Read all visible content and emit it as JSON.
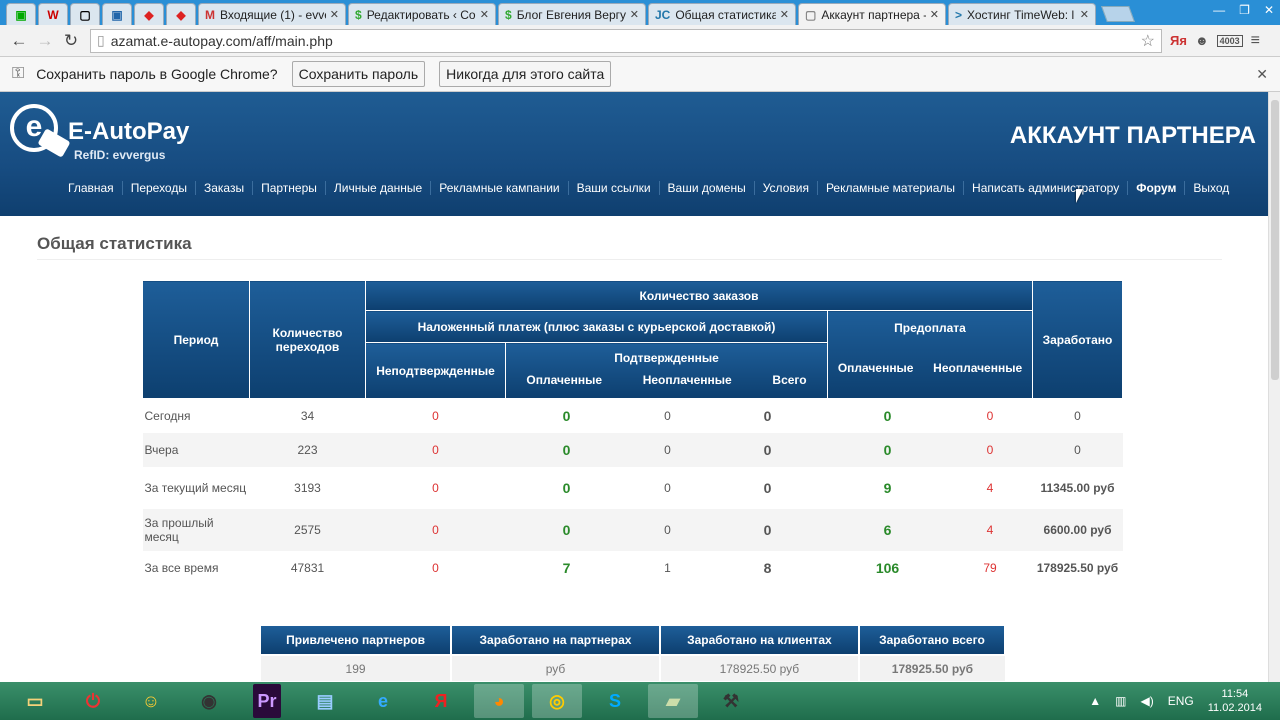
{
  "browser": {
    "tabs": [
      {
        "icon": "W",
        "title": "",
        "active": false
      },
      {
        "icon": "▢",
        "title": "",
        "active": false
      },
      {
        "icon": "▣",
        "title": "",
        "active": false
      },
      {
        "icon": "◆",
        "title": "",
        "active": false
      },
      {
        "icon": "◆",
        "title": "",
        "active": false
      },
      {
        "icon": "M",
        "title": "Входящие (1) - evve",
        "active": false
      },
      {
        "icon": "$",
        "title": "Редактировать ‹ Со",
        "active": false
      },
      {
        "icon": "$",
        "title": "Блог Евгения Вергу",
        "active": false
      },
      {
        "icon": "JC",
        "title": "Общая статистика",
        "active": false
      },
      {
        "icon": "▢",
        "title": "Аккаунт партнера -",
        "active": true
      },
      {
        "icon": ">",
        "title": "Хостинг TimeWeb: l",
        "active": false
      }
    ],
    "address": "azamat.e-autopay.com/aff/main.php",
    "ext_badge": "4003",
    "infobar": {
      "text": "Сохранить пароль в Google Chrome?",
      "save_btn": "Сохранить пароль",
      "never_btn": "Никогда для этого сайта"
    }
  },
  "site": {
    "brand": "E-AutoPay",
    "refid": "RefID: evvergus",
    "account_title": "АККАУНТ ПАРТНЕРА",
    "nav": [
      "Главная",
      "Переходы",
      "Заказы",
      "Партнеры",
      "Личные данные",
      "Рекламные кампании",
      "Ваши ссылки",
      "Ваши домены",
      "Условия",
      "Рекламные материалы",
      "Написать администратору",
      "Форум",
      "Выход"
    ]
  },
  "page_title": "Общая статистика",
  "stats": {
    "headers": {
      "period": "Период",
      "clicks": "Количество переходов",
      "orders": "Количество заказов",
      "cod": "Наложенный платеж (плюс заказы с курьерской доставкой)",
      "prepay": "Предоплата",
      "earned": "Заработано",
      "unconfirmed": "Неподтвержденные",
      "confirmed": "Подтвержденные",
      "paid": "Оплаченные",
      "unpaid": "Неоплаченные",
      "total": "Всего"
    },
    "rows": [
      {
        "period": "Сегодня",
        "clicks": "34",
        "unconf": "0",
        "paid": "0",
        "unpaid": "0",
        "total": "0",
        "pre_paid": "0",
        "pre_unpaid": "0",
        "earned": "0"
      },
      {
        "period": "Вчера",
        "clicks": "223",
        "unconf": "0",
        "paid": "0",
        "unpaid": "0",
        "total": "0",
        "pre_paid": "0",
        "pre_unpaid": "0",
        "earned": "0"
      },
      {
        "period": "За текущий месяц",
        "clicks": "3193",
        "unconf": "0",
        "paid": "0",
        "unpaid": "0",
        "total": "0",
        "pre_paid": "9",
        "pre_unpaid": "4",
        "earned": "11345.00 руб"
      },
      {
        "period": "За прошлый месяц",
        "clicks": "2575",
        "unconf": "0",
        "paid": "0",
        "unpaid": "0",
        "total": "0",
        "pre_paid": "6",
        "pre_unpaid": "4",
        "earned": "6600.00 руб"
      },
      {
        "period": "За все время",
        "clicks": "47831",
        "unconf": "0",
        "paid": "7",
        "unpaid": "1",
        "total": "8",
        "pre_paid": "106",
        "pre_unpaid": "79",
        "earned": "178925.50 руб"
      }
    ]
  },
  "summary": {
    "headers": [
      "Привлечено партнеров",
      "Заработано на партнерах",
      "Заработано на клиентах",
      "Заработано всего"
    ],
    "values": [
      "199",
      "руб",
      "178925.50 руб",
      "178925.50 руб"
    ]
  },
  "taskbar": {
    "lang": "ENG",
    "time": "11:54",
    "date": "11.02.2014"
  }
}
